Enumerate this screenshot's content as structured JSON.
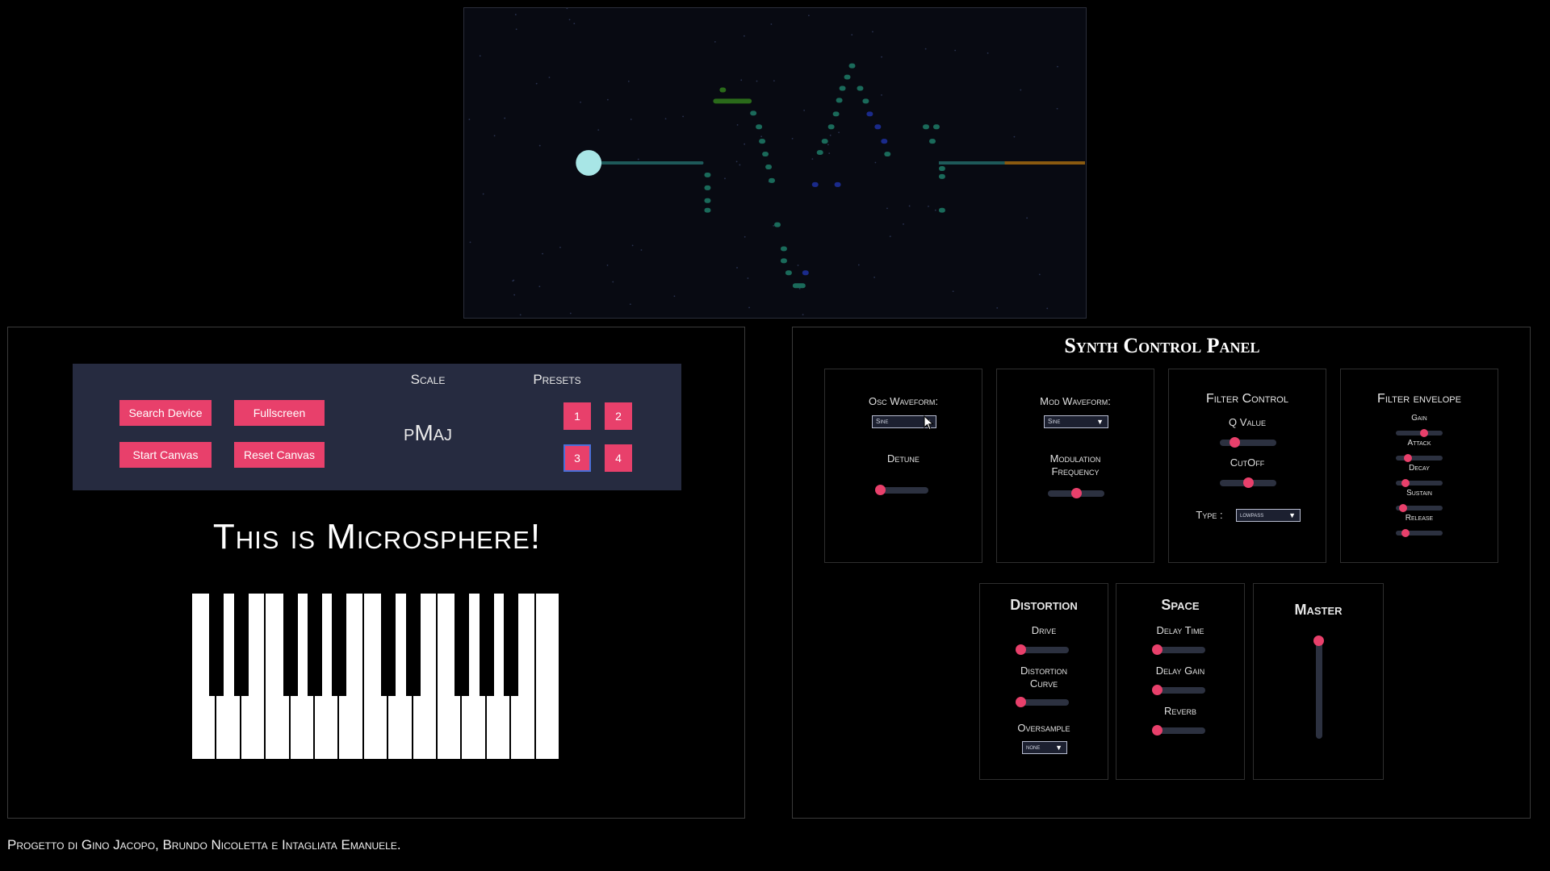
{
  "visualizer": {
    "colors": {
      "trail": "#1e5a5a",
      "ball": "#a8e6e6",
      "dot_teal": "#1a6a5a",
      "dot_blue": "#1a2a8a",
      "dot_green": "#2a6a1a",
      "trail_orange": "#8a5a10"
    }
  },
  "controls": {
    "search_device": "Search Device",
    "fullscreen": "Fullscreen",
    "start_canvas": "Start Canvas",
    "reset_canvas": "Reset Canvas",
    "scale_label": "Scale",
    "scale_value": "pMaj",
    "presets_label": "Presets",
    "presets": [
      "1",
      "2",
      "3",
      "4"
    ],
    "active_preset": "3"
  },
  "title": "This is Microsphere!",
  "synth": {
    "title": "Synth Control Panel",
    "osc": {
      "waveform_label": "Osc Waveform:",
      "waveform_value": "Sine",
      "detune_label": "Detune",
      "detune_level": 0.0
    },
    "mod": {
      "waveform_label": "Mod Waveform:",
      "waveform_value": "Sine",
      "freq_label_1": "Modulation",
      "freq_label_2": "Frequency",
      "freq_level": 0.5
    },
    "filter": {
      "title": "Filter Control",
      "q_label": "Q Value",
      "q_level": 0.25,
      "cutoff_label": "CutOff",
      "cutoff_level": 0.5,
      "type_label": "Type :",
      "type_value": "lowpass"
    },
    "envelope": {
      "title": "Filter envelope",
      "gain_label": "Gain",
      "gain_level": 0.6,
      "attack_label": "Attack",
      "attack_level": 0.25,
      "decay_label": "Decay",
      "decay_level": 0.2,
      "sustain_label": "Sustain",
      "sustain_level": 0.15,
      "release_label": "Release",
      "release_level": 0.2
    },
    "distortion": {
      "title": "Distortion",
      "drive_label": "Drive",
      "drive_level": 0.0,
      "curve_label_1": "Distortion",
      "curve_label_2": "Curve",
      "curve_level": 0.0,
      "oversample_label": "Oversample",
      "oversample_value": "none"
    },
    "space": {
      "title": "Space",
      "delay_time_label": "Delay Time",
      "delay_time_level": 0.0,
      "delay_gain_label": "Delay Gain",
      "delay_gain_level": 0.0,
      "reverb_label": "Reverb",
      "reverb_level": 0.0
    },
    "master": {
      "title": "Master",
      "level": 1.0
    },
    "accent": "#e8406b"
  },
  "footer": "Progetto di Gino Jacopo, Brundo Nicoletta e Intagliata Emanuele."
}
